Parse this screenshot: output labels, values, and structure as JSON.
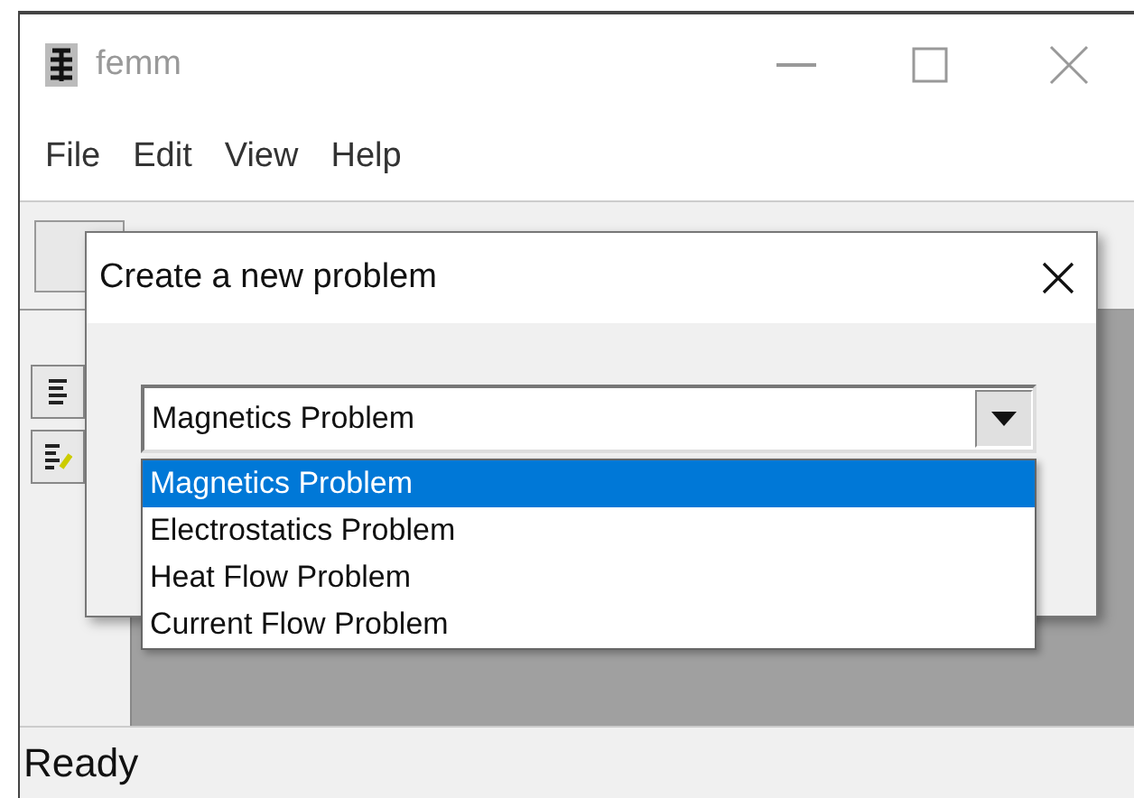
{
  "window": {
    "title": "femm"
  },
  "menu": [
    "File",
    "Edit",
    "View",
    "Help"
  ],
  "dialog": {
    "title": "Create a new problem",
    "combo": {
      "value": "Magnetics Problem",
      "expanded": true,
      "options": [
        {
          "label": "Magnetics Problem",
          "selected": true
        },
        {
          "label": "Electrostatics Problem",
          "selected": false
        },
        {
          "label": "Heat Flow Problem",
          "selected": false
        },
        {
          "label": "Current Flow Problem",
          "selected": false
        }
      ]
    }
  },
  "status_bar": "Ready"
}
